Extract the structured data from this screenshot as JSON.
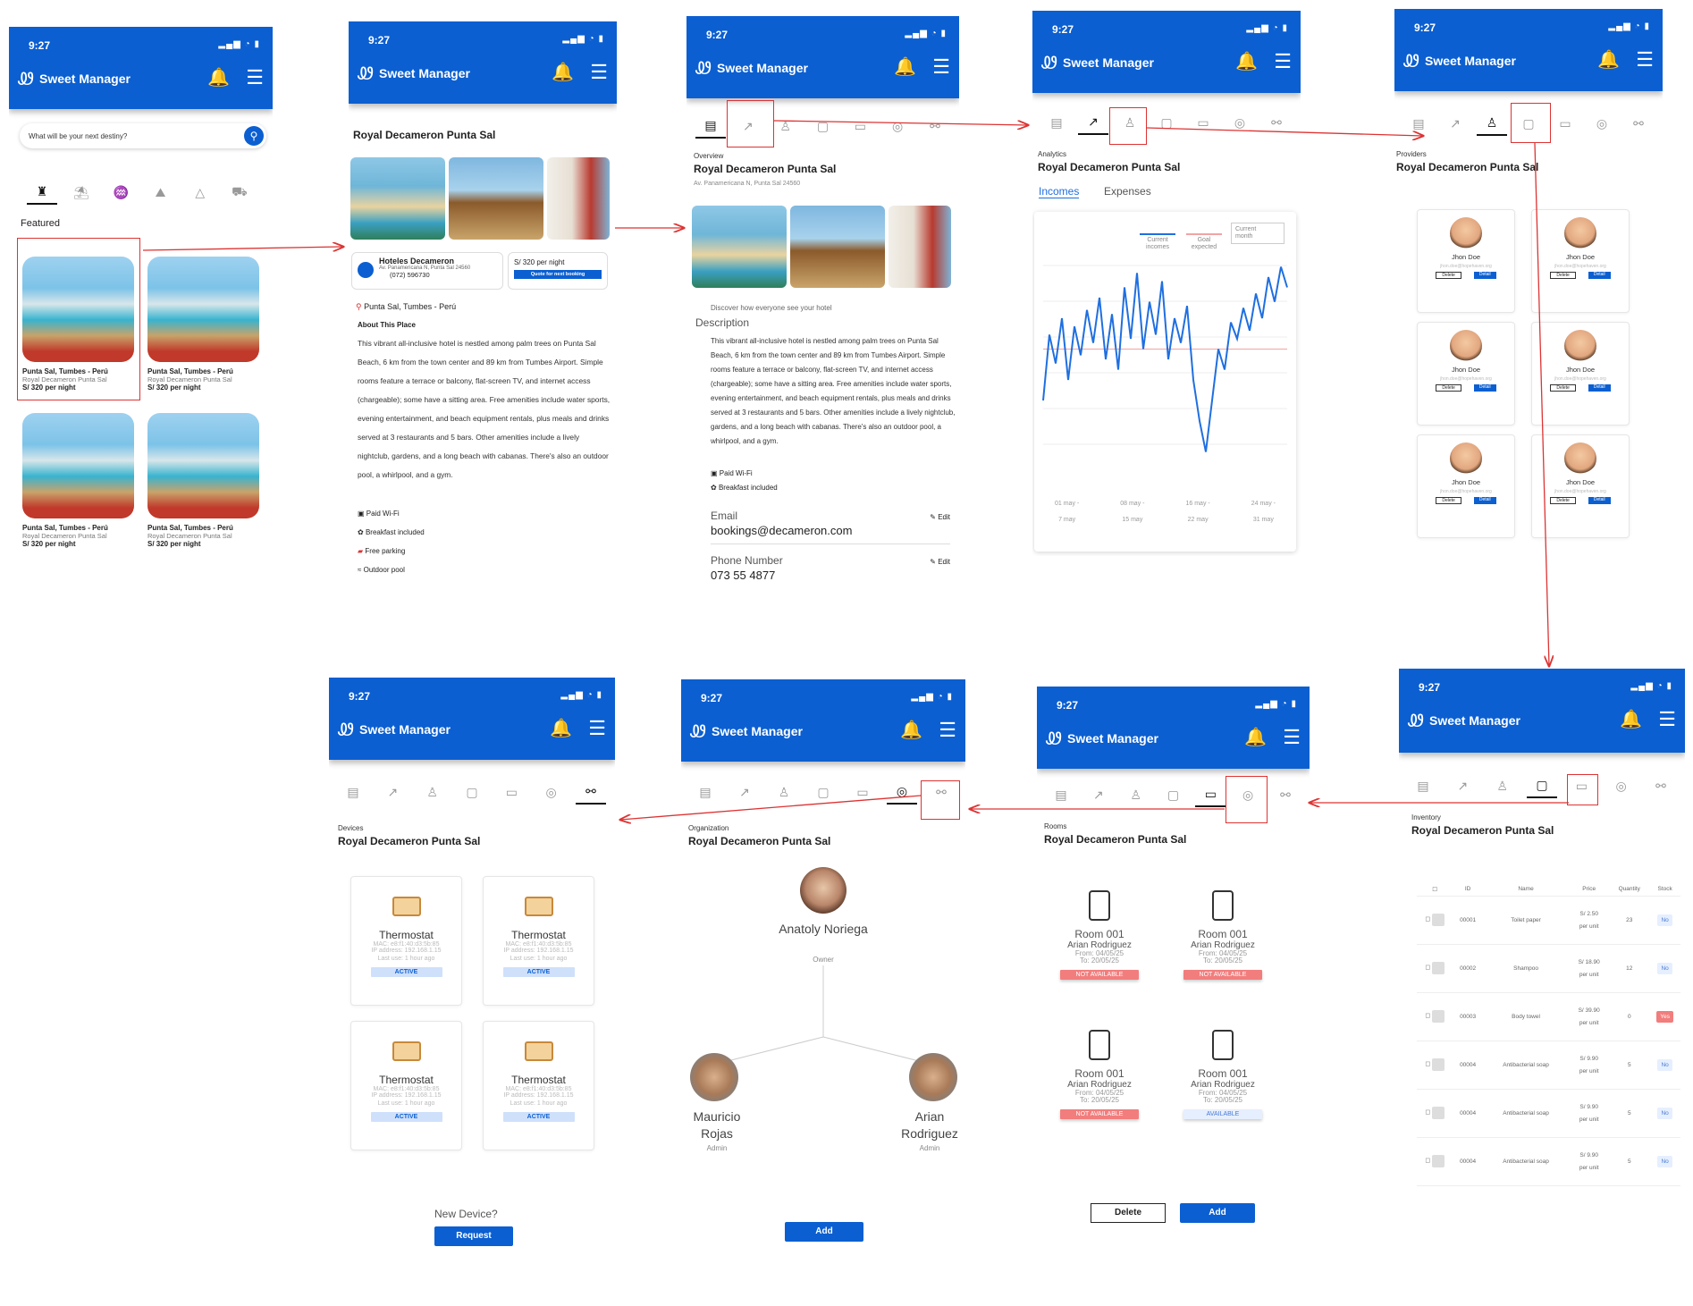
{
  "app": {
    "time": "9:27",
    "name": "Sweet Manager",
    "status_icons": "▂▄▆ ◔ ▮"
  },
  "home": {
    "search_placeholder": "What will be your next destiny?",
    "featured": "Featured",
    "hotels": [
      {
        "t1": "Punta Sal, Tumbes - Perú",
        "t2": "Royal Decameron Punta Sal",
        "t3": "S/ 320 per night"
      },
      {
        "t1": "Punta Sal, Tumbes - Perú",
        "t2": "Royal Decameron Punta Sal",
        "t3": "S/ 320 per night"
      },
      {
        "t1": "Punta Sal, Tumbes - Perú",
        "t2": "Royal Decameron Punta Sal",
        "t3": "S/ 320 per night"
      },
      {
        "t1": "Punta Sal, Tumbes - Perú",
        "t2": "Royal Decameron Punta Sal",
        "t3": "S/ 320 per night"
      }
    ]
  },
  "detail": {
    "title": "Royal Decameron Punta Sal",
    "owner_name": "Hoteles Decameron",
    "owner_addr": "Av. Panamericana N, Punta Sal 24560",
    "owner_phone": "(072) 596730",
    "price": "S/ 320 per night",
    "quote": "Quote for next booking",
    "location": "Punta Sal, Tumbes - Perú",
    "about": "About This Place",
    "text": "This vibrant all-inclusive hotel is nestled among palm trees on Punta Sal Beach, 6 km from the town center and 89 km from Tumbes Airport. Simple rooms feature a terrace or balcony, flat-screen TV, and internet access (chargeable); some have a sitting area. Free amenities include water sports, evening entertainment, and beach equipment rentals, plus meals and drinks served at 3 restaurants and 5 bars. Other amenities include a lively nightclub, gardens, and a long beach with cabanas. There's also an outdoor pool, a whirlpool, and a gym.",
    "amenities": [
      "Paid Wi-Fi",
      "Breakfast included",
      "Free parking",
      "Outdoor pool"
    ]
  },
  "overview": {
    "section": "Overview",
    "title": "Royal Decameron Punta Sal",
    "address": "Av. Panamericana N, Punta Sal 24560",
    "desc_hint": "Discover how everyone see your hotel",
    "desc_label": "Description",
    "text": "This vibrant all-inclusive hotel is nestled among palm trees on Punta Sal Beach, 6 km from the town center and 89 km from Tumbes Airport. Simple rooms feature a terrace or balcony, flat-screen TV, and internet access (chargeable); some have a sitting area. Free amenities include water sports, evening entertainment, and beach equipment rentals, plus meals and drinks served at 3 restaurants and 5 bars. Other amenities include a lively nightclub, gardens, and a long beach with cabanas. There's also an outdoor pool, a whirlpool, and a gym.",
    "amenities": [
      "Paid Wi-Fi",
      "Breakfast included"
    ],
    "email_label": "Email",
    "email": "bookings@decameron.com",
    "phone_label": "Phone Number",
    "phone": "073 55 4877",
    "edit": "Edit"
  },
  "analytics": {
    "section": "Analytics",
    "title": "Royal Decameron Punta Sal",
    "tab_in": "Incomes",
    "tab_out": "Expenses",
    "legend_current": "Current incomes",
    "legend_goal": "Goal expected",
    "period": "Current month",
    "x_ticks": [
      [
        "01 may -",
        "7 may"
      ],
      [
        "08 may -",
        "15 may"
      ],
      [
        "16 may -",
        "22 may"
      ],
      [
        "24 may -",
        "31 may"
      ]
    ]
  },
  "chart_data": {
    "type": "line",
    "title": "",
    "x": [
      "01 may - 7 may",
      "08 may - 15 may",
      "16 may - 22 may",
      "24 may - 31 may"
    ],
    "series": [
      {
        "name": "Current incomes",
        "values": [
          30,
          62,
          48,
          70,
          40,
          66,
          52,
          74,
          58,
          80,
          50,
          72,
          45,
          85,
          60,
          92,
          55,
          78,
          62,
          88,
          50,
          70,
          58,
          76,
          40,
          20,
          5,
          30,
          55,
          45,
          68,
          60,
          75,
          64,
          82,
          70,
          90,
          78,
          95,
          85
        ]
      },
      {
        "name": "Goal expected",
        "values": [
          55
        ]
      }
    ],
    "colors": {
      "incomes": "#1f6fe0",
      "goal": "#f2a3a3"
    }
  },
  "providers": {
    "section": "Providers",
    "title": "Royal Decameron Punta Sal",
    "items": [
      {
        "name": "Jhon Doe",
        "email": "jhon.doe@hopehaven.org"
      },
      {
        "name": "Jhon Doe",
        "email": "jhon.doe@hopehaven.org"
      },
      {
        "name": "Jhon Doe",
        "email": "jhon.doe@hopehaven.org"
      },
      {
        "name": "Jhon Doe",
        "email": "jhon.doe@hopehaven.org"
      },
      {
        "name": "Jhon Doe",
        "email": "jhon.doe@hopehaven.org"
      },
      {
        "name": "Jhon Doe",
        "email": "jhon.doe@hopehaven.org"
      }
    ],
    "delete": "Delete",
    "detail": "Detail"
  },
  "inventory": {
    "section": "Inventory",
    "title": "Royal Decameron Punta Sal",
    "headers": [
      "ID",
      "Name",
      "Price",
      "Quantity",
      "Stock"
    ],
    "rows": [
      {
        "id": "00001",
        "name": "Toilet paper",
        "price": "S/ 2.50",
        "unit": "per unit",
        "qty": "23",
        "stock": "No"
      },
      {
        "id": "00002",
        "name": "Shampoo",
        "price": "S/ 18.90",
        "unit": "per unit",
        "qty": "12",
        "stock": "No"
      },
      {
        "id": "00003",
        "name": "Body towel",
        "price": "S/ 39.90",
        "unit": "per unit",
        "qty": "0",
        "stock": "Yes"
      },
      {
        "id": "00004",
        "name": "Antibacterial soap",
        "price": "S/ 9.90",
        "unit": "per unit",
        "qty": "5",
        "stock": "No"
      },
      {
        "id": "00004",
        "name": "Antibacterial soap",
        "price": "S/ 9.90",
        "unit": "per unit",
        "qty": "5",
        "stock": "No"
      },
      {
        "id": "00004",
        "name": "Antibacterial soap",
        "price": "S/ 9.90",
        "unit": "per unit",
        "qty": "5",
        "stock": "No"
      }
    ]
  },
  "rooms": {
    "section": "Rooms",
    "title": "Royal Decameron Punta Sal",
    "items": [
      {
        "room": "Room 001",
        "guest": "Arian Rodriguez",
        "from": "From: 04/05/25",
        "to": "To: 20/05/25",
        "status": "NOT AVAILABLE"
      },
      {
        "room": "Room 001",
        "guest": "Arian Rodriguez",
        "from": "From: 04/05/25",
        "to": "To: 20/05/25",
        "status": "NOT AVAILABLE"
      },
      {
        "room": "Room 001",
        "guest": "Arian Rodriguez",
        "from": "From: 04/05/25",
        "to": "To: 20/05/25",
        "status": "NOT AVAILABLE"
      },
      {
        "room": "Room 001",
        "guest": "Arian Rodriguez",
        "from": "From: 04/05/25",
        "to": "To: 20/05/25",
        "status": "AVAILABLE"
      }
    ],
    "delete": "Delete",
    "add": "Add"
  },
  "organization": {
    "section": "Organization",
    "title": "Royal Decameron Punta Sal",
    "owner": "Anatoly Noriega",
    "owner_role": "Owner",
    "admins": [
      {
        "name": "Mauricio Rojas",
        "role": "Admin"
      },
      {
        "name": "Arian Rodriguez",
        "role": "Admin"
      }
    ],
    "add": "Add"
  },
  "devices": {
    "section": "Devices",
    "title": "Royal Decameron Punta Sal",
    "items": [
      {
        "name": "Thermostat",
        "mac": "MAC: e8:f1:40:d3:5b:85",
        "ip": "IP address: 192.168.1.15",
        "last": "Last use: 1 hour ago",
        "status": "ACTIVE"
      },
      {
        "name": "Thermostat",
        "mac": "MAC: e8:f1:40:d3:5b:85",
        "ip": "IP address: 192.168.1.15",
        "last": "Last use: 1 hour ago",
        "status": "ACTIVE"
      },
      {
        "name": "Thermostat",
        "mac": "MAC: e8:f1:40:d3:5b:85",
        "ip": "IP address: 192.168.1.15",
        "last": "Last use: 1 hour ago",
        "status": "ACTIVE"
      },
      {
        "name": "Thermostat",
        "mac": "MAC: e8:f1:40:d3:5b:85",
        "ip": "IP address: 192.168.1.15",
        "last": "Last use: 1 hour ago",
        "status": "ACTIVE"
      }
    ],
    "new": "New Device?",
    "request": "Request"
  }
}
